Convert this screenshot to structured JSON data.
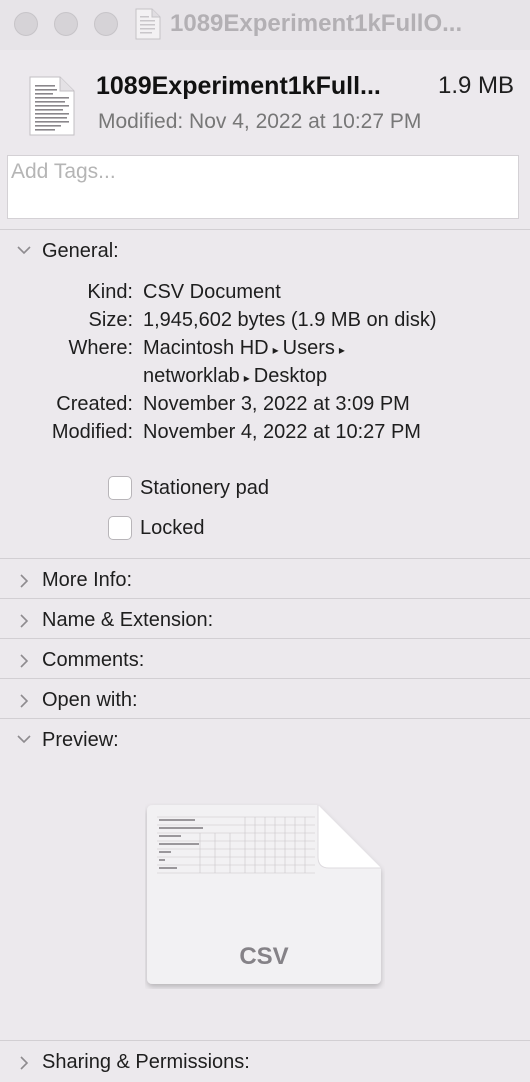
{
  "window": {
    "title": "1089Experiment1kFullO..."
  },
  "header": {
    "file_name": "1089Experiment1kFull...",
    "size": "1.9 MB",
    "modified": "Modified: Nov 4, 2022 at 10:27 PM"
  },
  "tags": {
    "placeholder": "Add Tags..."
  },
  "general": {
    "label": "General:",
    "kind_label": "Kind:",
    "kind_value": "CSV Document",
    "size_label": "Size:",
    "size_value": "1,945,602 bytes (1.9 MB on disk)",
    "where_label": "Where:",
    "where_path": [
      "Macintosh HD",
      "Users",
      "networklab",
      "Desktop"
    ],
    "created_label": "Created:",
    "created_value": "November 3, 2022 at 3:09 PM",
    "modified_label": "Modified:",
    "modified_value": "November 4, 2022 at 10:27 PM",
    "stationery_label": "Stationery pad",
    "locked_label": "Locked"
  },
  "sections": {
    "more_info": "More Info:",
    "name_ext": "Name & Extension:",
    "comments": "Comments:",
    "open_with": "Open with:",
    "preview": "Preview:",
    "sharing": "Sharing & Permissions:"
  },
  "preview": {
    "type_label": "CSV"
  },
  "icons": {
    "chevron_right": "chevron-right-icon",
    "chevron_down": "chevron-down-icon",
    "document": "document-icon"
  }
}
